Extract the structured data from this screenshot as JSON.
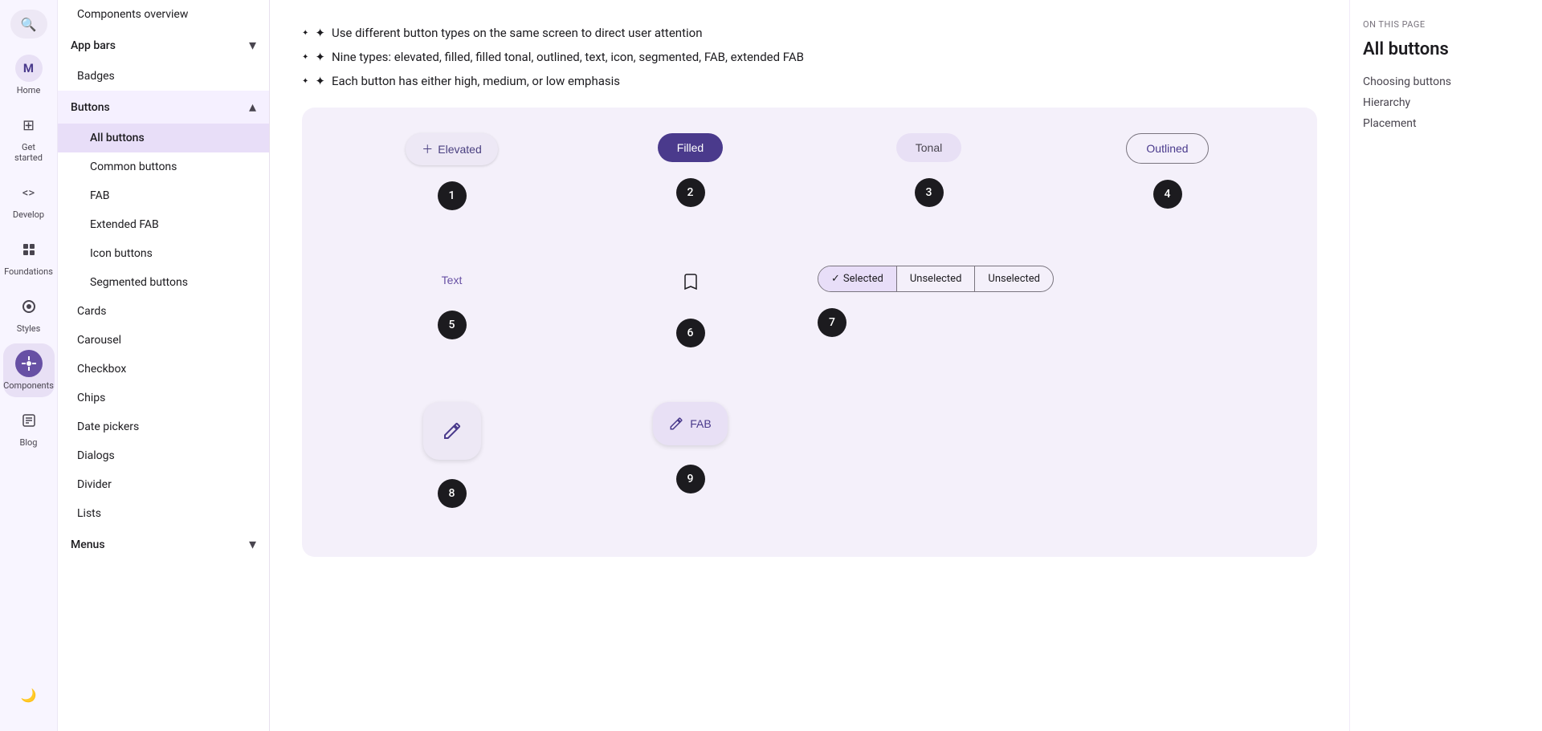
{
  "iconSidebar": {
    "searchIcon": "🔍",
    "items": [
      {
        "id": "home",
        "label": "Home",
        "icon": "M",
        "active": false
      },
      {
        "id": "get-started",
        "label": "Get started",
        "icon": "⊞",
        "active": false
      },
      {
        "id": "develop",
        "label": "Develop",
        "icon": "<>",
        "active": false
      },
      {
        "id": "foundations",
        "label": "Foundations",
        "icon": "⊟",
        "active": false
      },
      {
        "id": "styles",
        "label": "Styles",
        "icon": "◉",
        "active": false
      },
      {
        "id": "components",
        "label": "Components",
        "icon": "+",
        "active": true
      },
      {
        "id": "blog",
        "label": "Blog",
        "icon": "📝",
        "active": false
      }
    ]
  },
  "navSidebar": {
    "items": [
      {
        "id": "components-overview",
        "label": "Components overview",
        "indent": 0,
        "active": false,
        "hasChevron": false
      },
      {
        "id": "app-bars",
        "label": "App bars",
        "indent": 0,
        "active": false,
        "hasChevron": true
      },
      {
        "id": "badges",
        "label": "Badges",
        "indent": 0,
        "active": false,
        "hasChevron": false
      },
      {
        "id": "buttons",
        "label": "Buttons",
        "indent": 0,
        "active": false,
        "hasChevron": true,
        "expanded": true
      },
      {
        "id": "all-buttons",
        "label": "All buttons",
        "indent": 1,
        "active": true,
        "hasChevron": false
      },
      {
        "id": "common-buttons",
        "label": "Common buttons",
        "indent": 1,
        "active": false,
        "hasChevron": false
      },
      {
        "id": "fab",
        "label": "FAB",
        "indent": 1,
        "active": false,
        "hasChevron": false
      },
      {
        "id": "extended-fab",
        "label": "Extended FAB",
        "indent": 1,
        "active": false,
        "hasChevron": false
      },
      {
        "id": "icon-buttons",
        "label": "Icon buttons",
        "indent": 1,
        "active": false,
        "hasChevron": false
      },
      {
        "id": "segmented-buttons",
        "label": "Segmented buttons",
        "indent": 1,
        "active": false,
        "hasChevron": false
      },
      {
        "id": "cards",
        "label": "Cards",
        "indent": 0,
        "active": false,
        "hasChevron": false
      },
      {
        "id": "carousel",
        "label": "Carousel",
        "indent": 0,
        "active": false,
        "hasChevron": false
      },
      {
        "id": "checkbox",
        "label": "Checkbox",
        "indent": 0,
        "active": false,
        "hasChevron": false
      },
      {
        "id": "chips",
        "label": "Chips",
        "indent": 0,
        "active": false,
        "hasChevron": false
      },
      {
        "id": "date-pickers",
        "label": "Date pickers",
        "indent": 0,
        "active": false,
        "hasChevron": false
      },
      {
        "id": "dialogs",
        "label": "Dialogs",
        "indent": 0,
        "active": false,
        "hasChevron": false
      },
      {
        "id": "divider",
        "label": "Divider",
        "indent": 0,
        "active": false,
        "hasChevron": false
      },
      {
        "id": "lists",
        "label": "Lists",
        "indent": 0,
        "active": false,
        "hasChevron": false
      },
      {
        "id": "menus",
        "label": "Menus",
        "indent": 0,
        "active": false,
        "hasChevron": true
      }
    ]
  },
  "mainContent": {
    "bullets": [
      "Use different button types on the same screen to direct user attention",
      "Nine types: elevated, filled, filled tonal, outlined, text, icon, segmented, FAB, extended FAB",
      "Each button has either high, medium, or low emphasis"
    ],
    "demo": {
      "row1": [
        {
          "type": "elevated",
          "label": "Elevated",
          "num": "1"
        },
        {
          "type": "filled",
          "label": "Filled",
          "num": "2"
        },
        {
          "type": "tonal",
          "label": "Tonal",
          "num": "3"
        },
        {
          "type": "outlined",
          "label": "Outlined",
          "num": "4"
        }
      ],
      "row2": [
        {
          "type": "text",
          "label": "Text",
          "num": "5"
        },
        {
          "type": "icon",
          "label": "",
          "num": "6"
        },
        {
          "type": "segmented",
          "label": "",
          "num": "7",
          "segments": [
            {
              "label": "Selected",
              "selected": true
            },
            {
              "label": "Unselected",
              "selected": false
            },
            {
              "label": "Unselected",
              "selected": false
            }
          ]
        }
      ],
      "row3": [
        {
          "type": "fab",
          "label": "",
          "num": "8"
        },
        {
          "type": "fab-extended",
          "label": "FAB",
          "num": "9"
        }
      ]
    }
  },
  "toc": {
    "onThisPage": "On this page",
    "title": "All buttons",
    "links": [
      "Choosing buttons",
      "Hierarchy",
      "Placement"
    ]
  },
  "colors": {
    "purple": "#6750a4",
    "purpleDark": "#4a3a8c",
    "purpleLight": "#e8def8",
    "surface": "#f4f0fa",
    "border": "#79747e"
  }
}
